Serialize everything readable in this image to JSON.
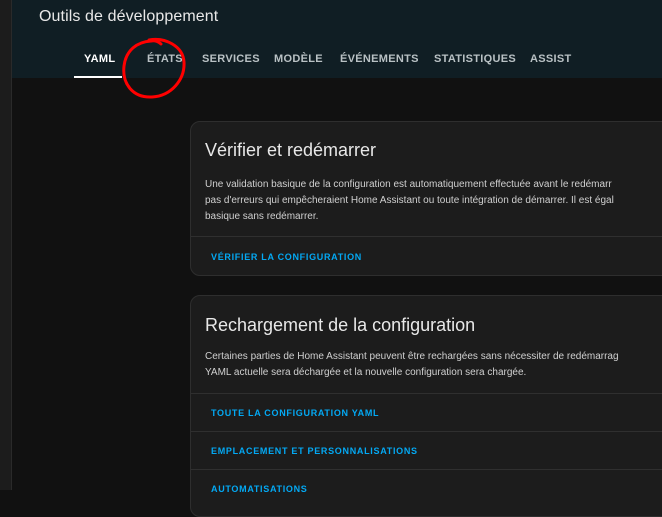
{
  "header": {
    "title": "Outils de développement",
    "tabs": [
      {
        "label": "YAML"
      },
      {
        "label": "ÉTATS"
      },
      {
        "label": "SERVICES"
      },
      {
        "label": "MODÈLE"
      },
      {
        "label": "ÉVÉNEMENTS"
      },
      {
        "label": "STATISTIQUES"
      },
      {
        "label": "ASSIST"
      }
    ],
    "active_tab": "YAML",
    "annotation_color": "#ff0000"
  },
  "cards": [
    {
      "title": "Vérifier et redémarrer",
      "text_lines": [
        "Une validation basique de la configuration est automatiquement effectuée avant le redémarr",
        "pas d'erreurs qui empêcheraient Home Assistant ou toute intégration de démarrer. Il est égal",
        "basique sans redémarrer."
      ],
      "actions": [
        "VÉRIFIER LA CONFIGURATION"
      ]
    },
    {
      "title": "Rechargement de la configuration",
      "text_lines": [
        "Certaines parties de Home Assistant peuvent être rechargées sans nécessiter de redémarrag",
        "YAML actuelle sera déchargée et la nouvelle configuration sera chargée."
      ],
      "actions": [
        "TOUTE LA CONFIGURATION YAML",
        "EMPLACEMENT ET PERSONNALISATIONS",
        "AUTOMATISATIONS"
      ]
    }
  ],
  "colors": {
    "accent": "#03a9f4",
    "header_bg": "#101e24",
    "card_bg": "#1c1c1c",
    "page_bg": "#111111"
  }
}
